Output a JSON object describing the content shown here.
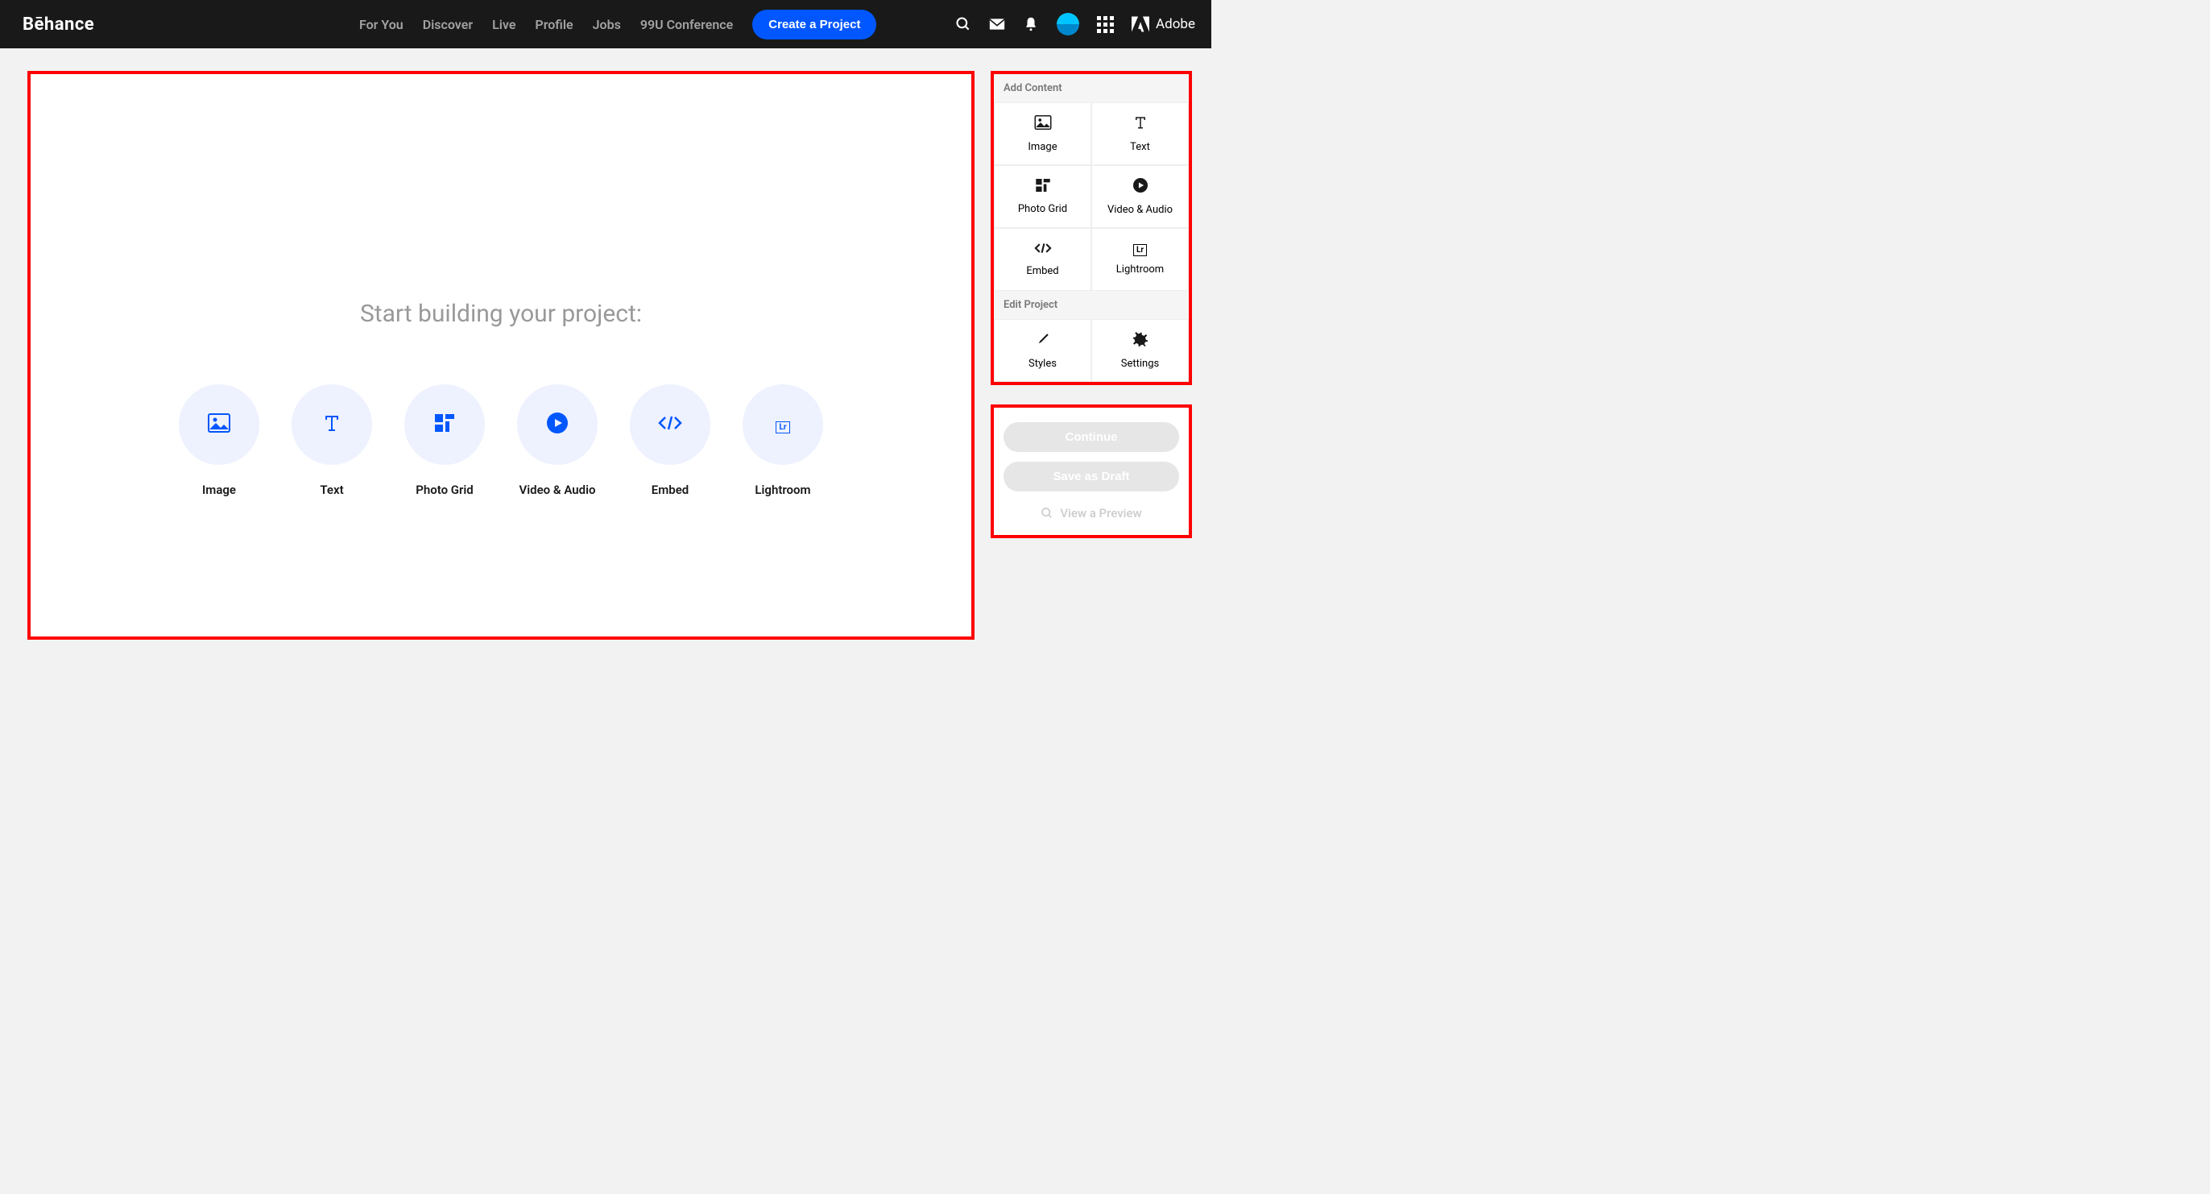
{
  "header": {
    "logo": "Bēhance",
    "nav": [
      "For You",
      "Discover",
      "Live",
      "Profile",
      "Jobs",
      "99U Conference"
    ],
    "cta": "Create a Project",
    "adobe": "Adobe"
  },
  "canvas": {
    "title": "Start building your project:",
    "tools": [
      {
        "id": "image",
        "label": "Image"
      },
      {
        "id": "text",
        "label": "Text"
      },
      {
        "id": "photo-grid",
        "label": "Photo Grid"
      },
      {
        "id": "video-audio",
        "label": "Video & Audio"
      },
      {
        "id": "embed",
        "label": "Embed"
      },
      {
        "id": "lightroom",
        "label": "Lightroom"
      }
    ]
  },
  "sidebar": {
    "addContentTitle": "Add Content",
    "addContent": [
      {
        "id": "image",
        "label": "Image"
      },
      {
        "id": "text",
        "label": "Text"
      },
      {
        "id": "photo-grid",
        "label": "Photo Grid"
      },
      {
        "id": "video-audio",
        "label": "Video & Audio"
      },
      {
        "id": "embed",
        "label": "Embed"
      },
      {
        "id": "lightroom",
        "label": "Lightroom"
      }
    ],
    "editProjectTitle": "Edit Project",
    "editProject": [
      {
        "id": "styles",
        "label": "Styles"
      },
      {
        "id": "settings",
        "label": "Settings"
      }
    ]
  },
  "actions": {
    "continue": "Continue",
    "saveDraft": "Save as Draft",
    "preview": "View a Preview"
  }
}
